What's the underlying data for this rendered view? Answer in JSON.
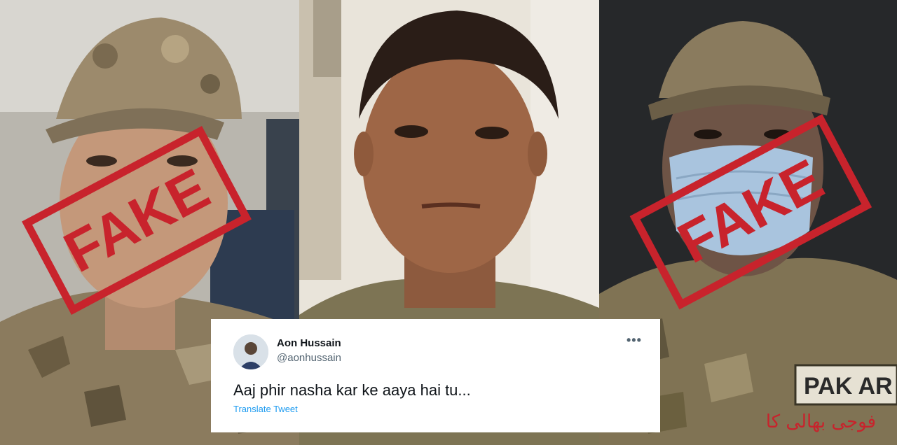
{
  "panels": {
    "left": {
      "stamp": "FAKE"
    },
    "right": {
      "stamp": "FAKE",
      "patch": "PAK AR",
      "overlay_text": "فوجی بھالی کا"
    }
  },
  "tweet": {
    "name": "Aon Hussain",
    "handle": "@aonhussain",
    "text": "Aaj phir nasha kar ke aaya hai tu...",
    "translate": "Translate Tweet",
    "more_icon": "more-horizontal-icon"
  },
  "colors": {
    "stamp": "#c8232c",
    "link": "#1d9bf0"
  }
}
